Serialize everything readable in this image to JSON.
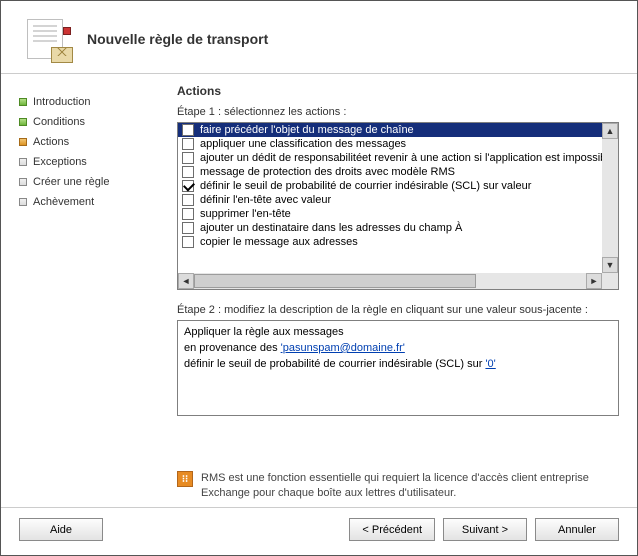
{
  "title": "Nouvelle règle de transport",
  "sidebar": {
    "items": [
      {
        "label": "Introduction",
        "state": "done"
      },
      {
        "label": "Conditions",
        "state": "done"
      },
      {
        "label": "Actions",
        "state": "current"
      },
      {
        "label": "Exceptions",
        "state": "todo"
      },
      {
        "label": "Créer une règle",
        "state": "todo"
      },
      {
        "label": "Achèvement",
        "state": "todo"
      }
    ]
  },
  "main": {
    "heading": "Actions",
    "step1_label": "Étape 1 : sélectionnez les actions :",
    "actions": [
      {
        "checked": false,
        "label": "faire précéder l'objet du message de chaîne"
      },
      {
        "checked": false,
        "label": "appliquer une classification des messages"
      },
      {
        "checked": false,
        "label": "ajouter un dédit de responsabilitéet revenir à une action si l'application est impossible"
      },
      {
        "checked": false,
        "label": "message de protection des droits avec modèle RMS"
      },
      {
        "checked": true,
        "label": "définir le seuil de probabilité de courrier indésirable (SCL) sur valeur"
      },
      {
        "checked": false,
        "label": "définir l'en-tête avec valeur"
      },
      {
        "checked": false,
        "label": "supprimer l'en-tête"
      },
      {
        "checked": false,
        "label": "ajouter un destinataire dans les adresses du champ À"
      },
      {
        "checked": false,
        "label": "copier le message aux adresses"
      }
    ],
    "step2_label": "Étape 2 : modifiez la description de la règle en cliquant sur une valeur sous-jacente :",
    "description": {
      "line1": "Appliquer la règle aux messages",
      "line2_prefix": "en provenance des ",
      "line2_link": "'pasunspam@domaine.fr'",
      "line3_prefix": "définir le seuil de probabilité de courrier indésirable (SCL) sur ",
      "line3_link": "'0'"
    },
    "rms_note": "RMS est une fonction essentielle qui requiert la licence d'accès client entreprise Exchange pour chaque boîte aux lettres d'utilisateur."
  },
  "footer": {
    "help": "Aide",
    "back": "< Précédent",
    "next": "Suivant >",
    "cancel": "Annuler"
  }
}
